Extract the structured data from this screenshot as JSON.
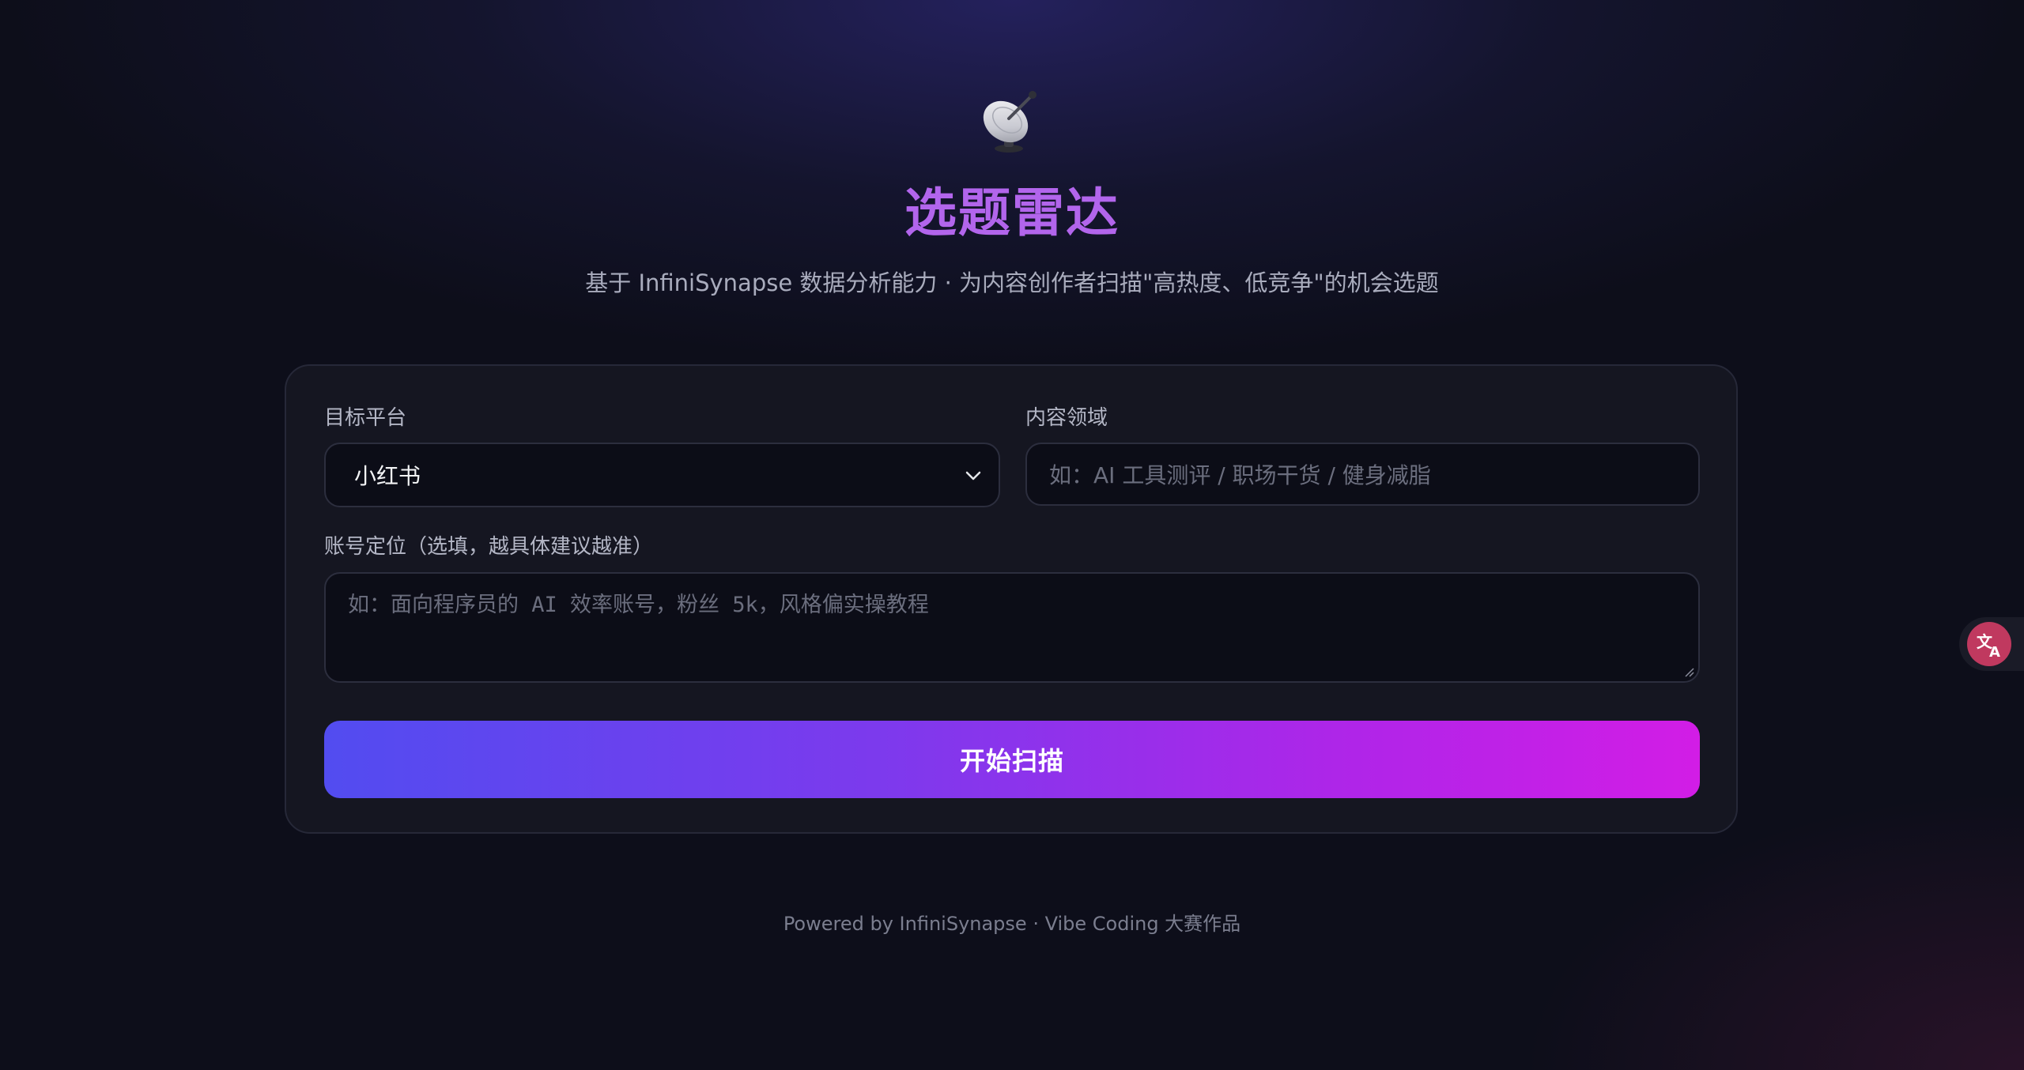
{
  "header": {
    "logo_icon": "satellite-dish-icon",
    "title": "选题雷达",
    "subtitle": "基于 InfiniSynapse 数据分析能力 · 为内容创作者扫描\"高热度、低竞争\"的机会选题",
    "title_color": "#b265ec"
  },
  "form": {
    "platform": {
      "label": "目标平台",
      "selected": "小红书"
    },
    "domain": {
      "label": "内容领域",
      "placeholder": "如：AI 工具测评 / 职场干货 / 健身减脂"
    },
    "positioning": {
      "label": "账号定位（选填，越具体建议越准）",
      "placeholder": "如：面向程序员的 AI 效率账号，粉丝 5k，风格偏实操教程"
    },
    "submit_label": "开始扫描",
    "button_gradient": [
      "#524cf0",
      "#d21de6"
    ]
  },
  "footer": {
    "text": "Powered by InfiniSynapse · Vibe Coding 大赛作品"
  },
  "floating": {
    "translate_icon": "translate-icon",
    "translate_color": "#c0395f"
  }
}
